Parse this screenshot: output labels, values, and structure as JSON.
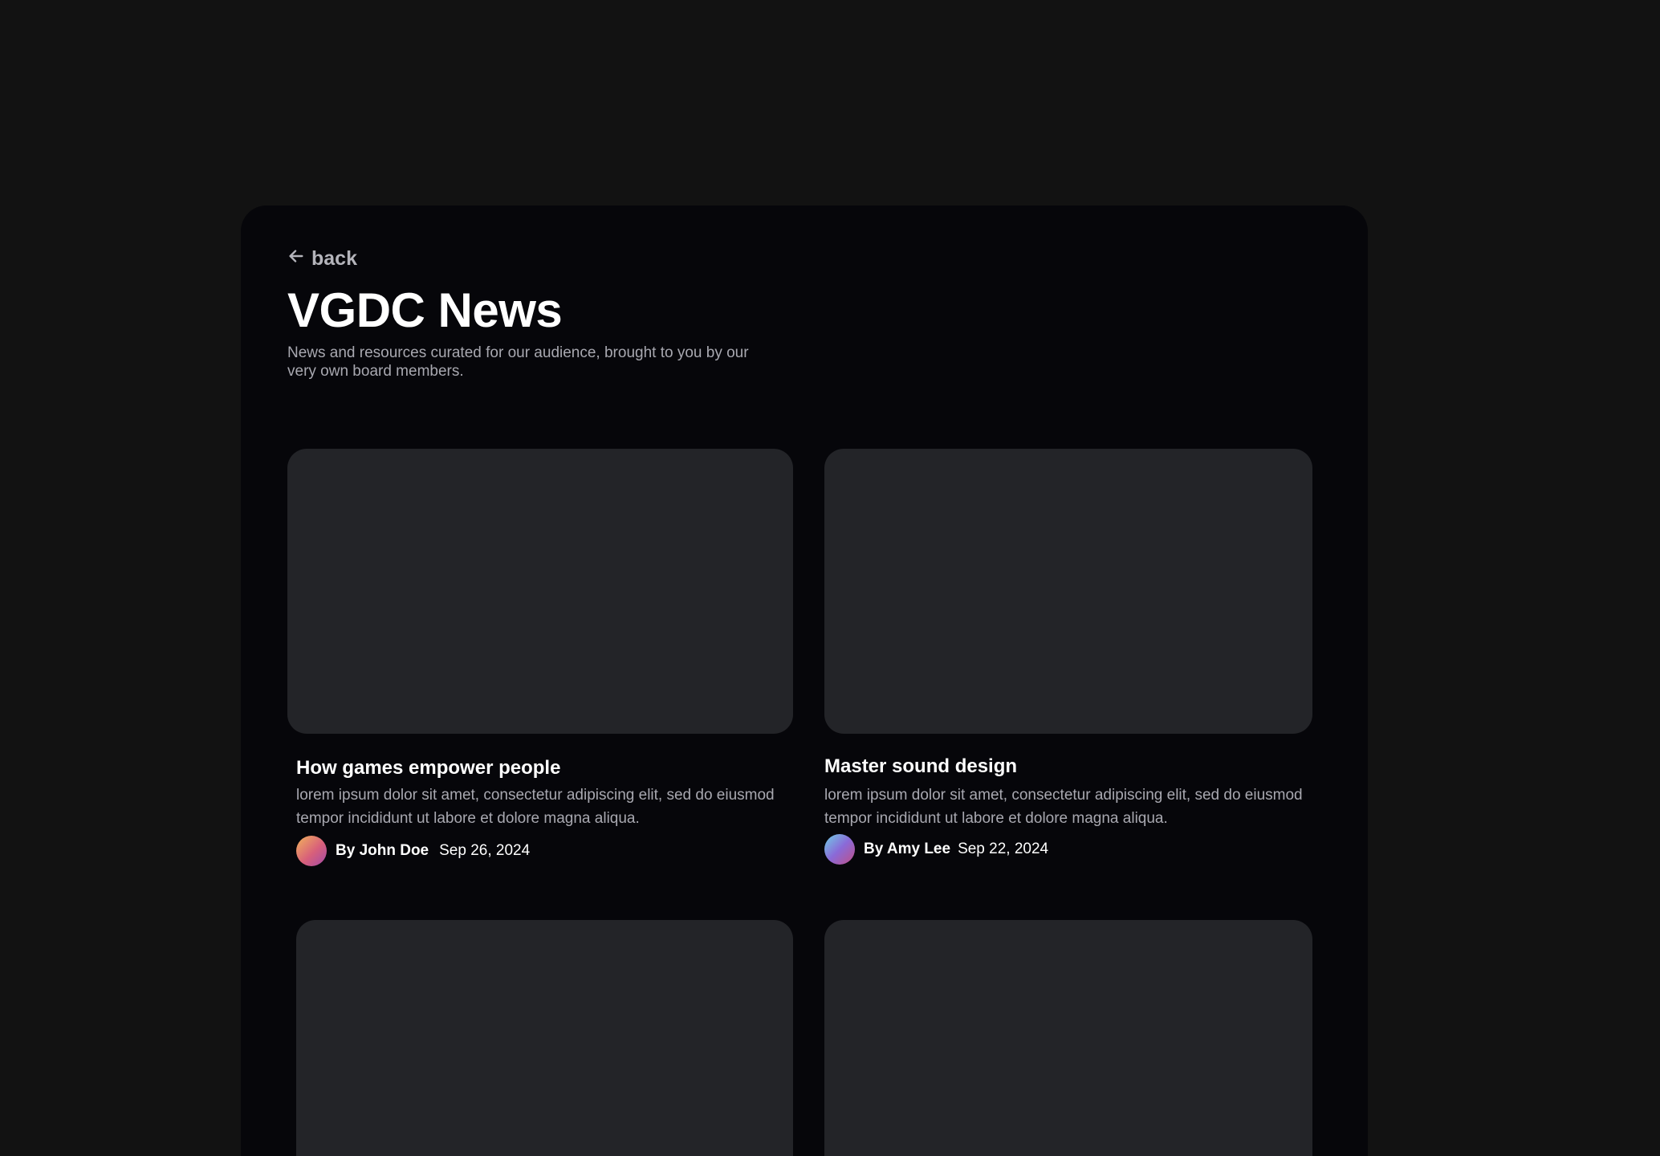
{
  "header": {
    "back_label": "back",
    "title": "VGDC News",
    "subtitle": "News and resources curated for our audience, brought to you by our very own board members."
  },
  "articles": [
    {
      "title": "How games empower people",
      "excerpt": "lorem ipsum dolor sit amet, consectetur adipiscing elit, sed do eiusmod tempor incididunt ut labore et dolore magna aliqua.",
      "author": "By John Doe",
      "date": "Sep 26, 2024"
    },
    {
      "title": "Master sound design",
      "excerpt": "lorem ipsum dolor sit amet, consectetur adipiscing elit, sed do eiusmod tempor incididunt ut labore et dolore magna aliqua.",
      "author": "By Amy Lee",
      "date": "Sep 22, 2024"
    }
  ],
  "colors": {
    "page_background": "#121212",
    "panel_background": "#06060a",
    "thumbnail_placeholder": "#232428",
    "heading_text": "#ffffff",
    "muted_text": "#a8a8b0"
  },
  "icons": {
    "back": "arrow-left-icon"
  }
}
